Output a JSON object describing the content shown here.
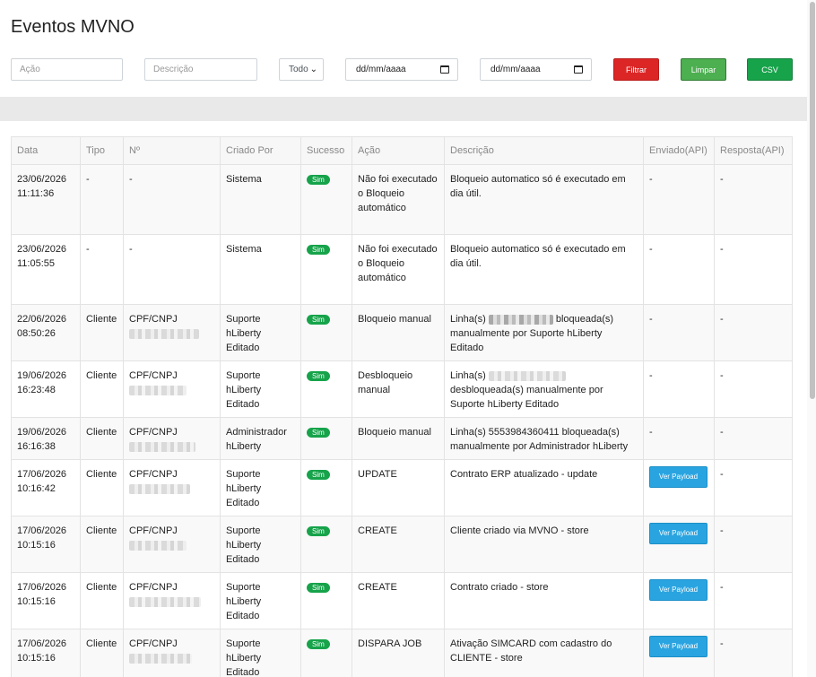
{
  "page": {
    "title": "Eventos MVNO"
  },
  "filters": {
    "acao_placeholder": "Ação",
    "descricao_placeholder": "Descrição",
    "tipo_selected": "Todos",
    "date_from": "dd/mm/aaaa",
    "date_to": "dd/mm/aaaa",
    "filtrar_label": "Filtrar",
    "limpar_label": "Limpar",
    "csv_label": "CSV"
  },
  "colors": {
    "danger": "#dc2626",
    "success": "#16a34a",
    "info": "#2aa4e0"
  },
  "table": {
    "headers": [
      "Data",
      "Tipo",
      "Nº",
      "Criado Por",
      "Sucesso",
      "Ação",
      "Descrição",
      "Enviado(API)",
      "Resposta(API)"
    ],
    "rows": [
      {
        "date": "23/06/2026",
        "time": "11:11:36",
        "tipo": "-",
        "numero_label": "-",
        "numero_redacted": false,
        "criado_por": "Sistema",
        "sucesso": "Sim",
        "acao": "Não foi executado o Bloqueio automático",
        "descricao": "Bloqueio automatico só é executado em dia útil.",
        "enviado": "-",
        "enviado_button": false,
        "resposta": "-"
      },
      {
        "date": "23/06/2026",
        "time": "11:05:55",
        "tipo": "-",
        "numero_label": "-",
        "numero_redacted": false,
        "criado_por": "Sistema",
        "sucesso": "Sim",
        "acao": "Não foi executado o Bloqueio automático",
        "descricao": "Bloqueio automatico só é executado em dia útil.",
        "enviado": "-",
        "enviado_button": false,
        "resposta": "-"
      },
      {
        "date": "22/06/2026",
        "time": "08:50:26",
        "tipo": "Cliente",
        "numero_label": "CPF/CNPJ",
        "numero_redacted": true,
        "criado_por": "Suporte hLiberty Editado",
        "sucesso": "Sim",
        "acao": "Bloqueio manual",
        "descricao_prefix": "Linha(s)",
        "descricao_suffix": "bloqueada(s) manualmente por Suporte hLiberty Editado",
        "descricao_redacted": true,
        "enviado": "-",
        "enviado_button": false,
        "resposta": "-"
      },
      {
        "date": "19/06/2026",
        "time": "16:23:48",
        "tipo": "Cliente",
        "numero_label": "CPF/CNPJ",
        "numero_redacted": true,
        "criado_por": "Suporte hLiberty Editado",
        "sucesso": "Sim",
        "acao": "Desbloqueio manual",
        "descricao_prefix": "Linha(s)",
        "descricao_suffix": "desbloqueada(s) manualmente por Suporte hLiberty Editado",
        "descricao_redacted": true,
        "enviado": "-",
        "enviado_button": false,
        "resposta": "-"
      },
      {
        "date": "19/06/2026",
        "time": "16:16:38",
        "tipo": "Cliente",
        "numero_label": "CPF/CNPJ",
        "numero_redacted": true,
        "criado_por": "Administrador hLiberty",
        "sucesso": "Sim",
        "acao": "Bloqueio manual",
        "descricao": "Linha(s) 5553984360411 bloqueada(s) manualmente por Administrador hLiberty",
        "enviado": "-",
        "enviado_button": false,
        "resposta": "-"
      },
      {
        "date": "17/06/2026",
        "time": "10:16:42",
        "tipo": "Cliente",
        "numero_label": "CPF/CNPJ",
        "numero_redacted": true,
        "criado_por": "Suporte hLiberty Editado",
        "sucesso": "Sim",
        "acao": "UPDATE",
        "descricao": "Contrato ERP atualizado - update",
        "enviado": "Ver Payload",
        "enviado_button": true,
        "resposta": "-"
      },
      {
        "date": "17/06/2026",
        "time": "10:15:16",
        "tipo": "Cliente",
        "numero_label": "CPF/CNPJ",
        "numero_redacted": true,
        "criado_por": "Suporte hLiberty Editado",
        "sucesso": "Sim",
        "acao": "CREATE",
        "descricao": "Cliente criado via MVNO - store",
        "enviado": "Ver Payload",
        "enviado_button": true,
        "resposta": "-"
      },
      {
        "date": "17/06/2026",
        "time": "10:15:16",
        "tipo": "Cliente",
        "numero_label": "CPF/CNPJ",
        "numero_redacted": true,
        "criado_por": "Suporte hLiberty Editado",
        "sucesso": "Sim",
        "acao": "CREATE",
        "descricao": "Contrato criado - store",
        "enviado": "Ver Payload",
        "enviado_button": true,
        "resposta": "-"
      },
      {
        "date": "17/06/2026",
        "time": "10:15:16",
        "tipo": "Cliente",
        "numero_label": "CPF/CNPJ",
        "numero_redacted": true,
        "criado_por": "Suporte hLiberty Editado",
        "sucesso": "Sim",
        "acao": "DISPARA JOB",
        "descricao": "Ativação SIMCARD com cadastro do CLIENTE - store",
        "enviado": "Ver Payload",
        "enviado_button": true,
        "resposta": "-"
      }
    ]
  }
}
